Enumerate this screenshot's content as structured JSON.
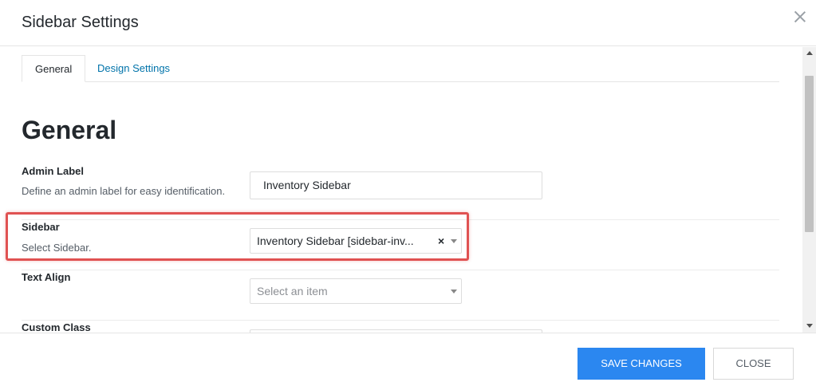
{
  "modal": {
    "title": "Sidebar Settings"
  },
  "tabs": [
    {
      "label": "General",
      "active": true
    },
    {
      "label": "Design Settings",
      "active": false
    }
  ],
  "section": {
    "heading": "General"
  },
  "fields": {
    "admin_label": {
      "label": "Admin Label",
      "description": "Define an admin label for easy identification.",
      "value": "Inventory Sidebar"
    },
    "sidebar": {
      "label": "Sidebar",
      "description": "Select Sidebar.",
      "selected": "Inventory Sidebar [sidebar-inv..."
    },
    "text_align": {
      "label": "Text Align",
      "placeholder": "Select an item"
    },
    "custom_class": {
      "label": "Custom Class"
    }
  },
  "footer": {
    "save_label": "SAVE CHANGES",
    "close_label": "CLOSE"
  },
  "colors": {
    "primary_button": "#2b87f0",
    "tab_link": "#0073aa",
    "highlight": "#e05252"
  },
  "icons": {
    "close": "close-icon",
    "clear": "clear-selection-icon",
    "dropdown": "chevron-down-icon"
  }
}
